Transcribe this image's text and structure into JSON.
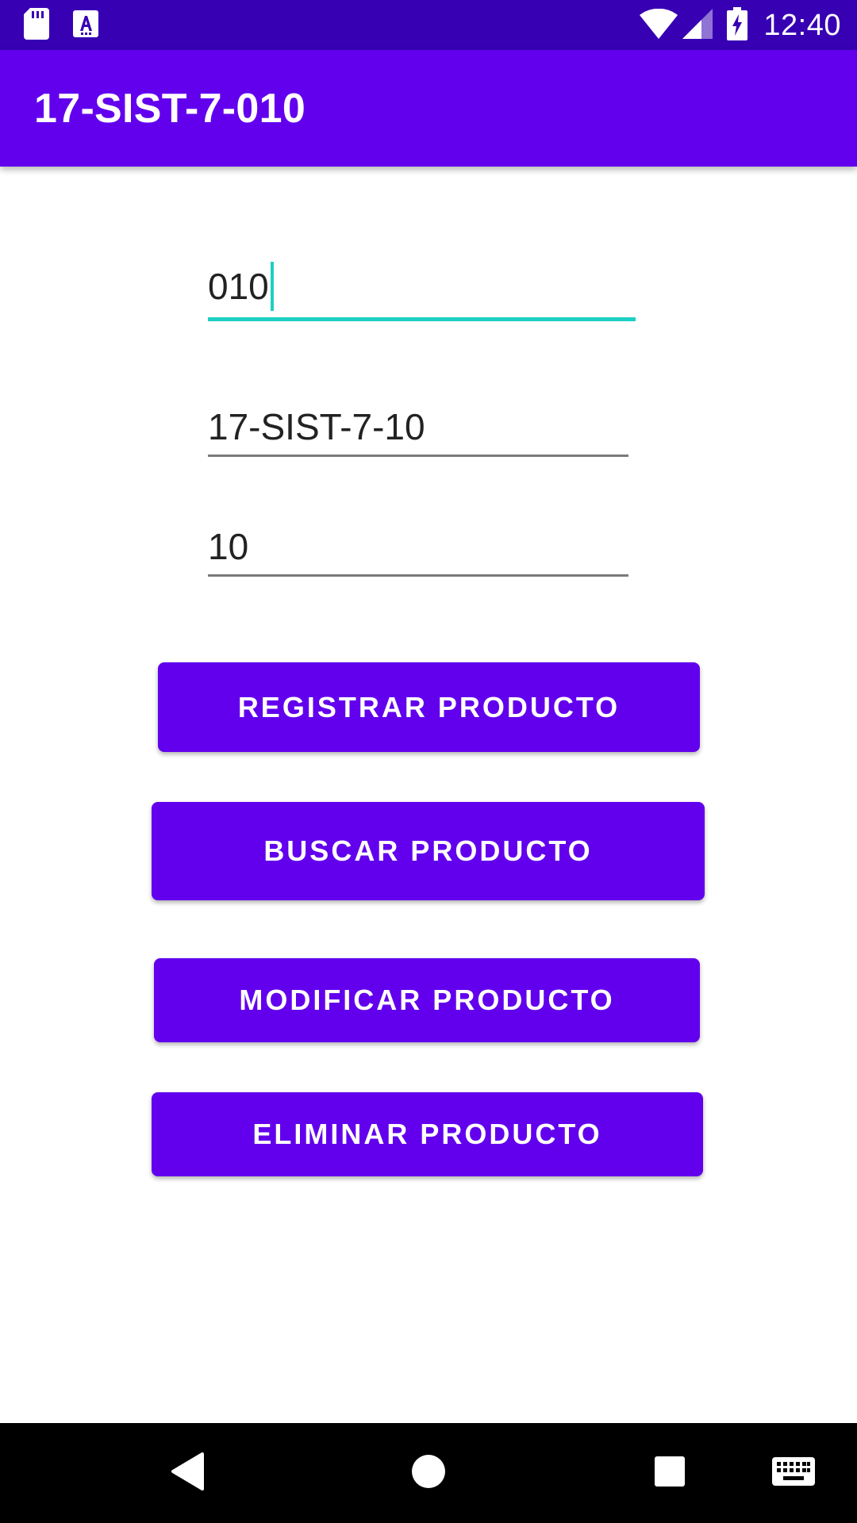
{
  "status_bar": {
    "time": "12:40",
    "icons": [
      "sd-card-icon",
      "font-download-icon",
      "wifi-icon",
      "cell-signal-icon",
      "battery-charging-icon"
    ]
  },
  "app_bar": {
    "title": "17-SIST-7-010"
  },
  "form": {
    "code_field": {
      "value": "010"
    },
    "description_field": {
      "value": "17-SIST-7-10"
    },
    "price_field": {
      "value": "10"
    }
  },
  "buttons": {
    "register": "REGISTRAR PRODUCTO",
    "search": "BUSCAR PRODUCTO",
    "modify": "MODIFICAR PRODUCTO",
    "delete": "ELIMINAR PRODUCTO"
  },
  "navigation": {
    "icons": [
      "back-icon",
      "home-icon",
      "recents-icon",
      "keyboard-icon"
    ]
  },
  "colors": {
    "status_bar": "#3700B3",
    "primary": "#6200EE",
    "accent": "#1DD0C3",
    "nav_bar": "#000000"
  }
}
